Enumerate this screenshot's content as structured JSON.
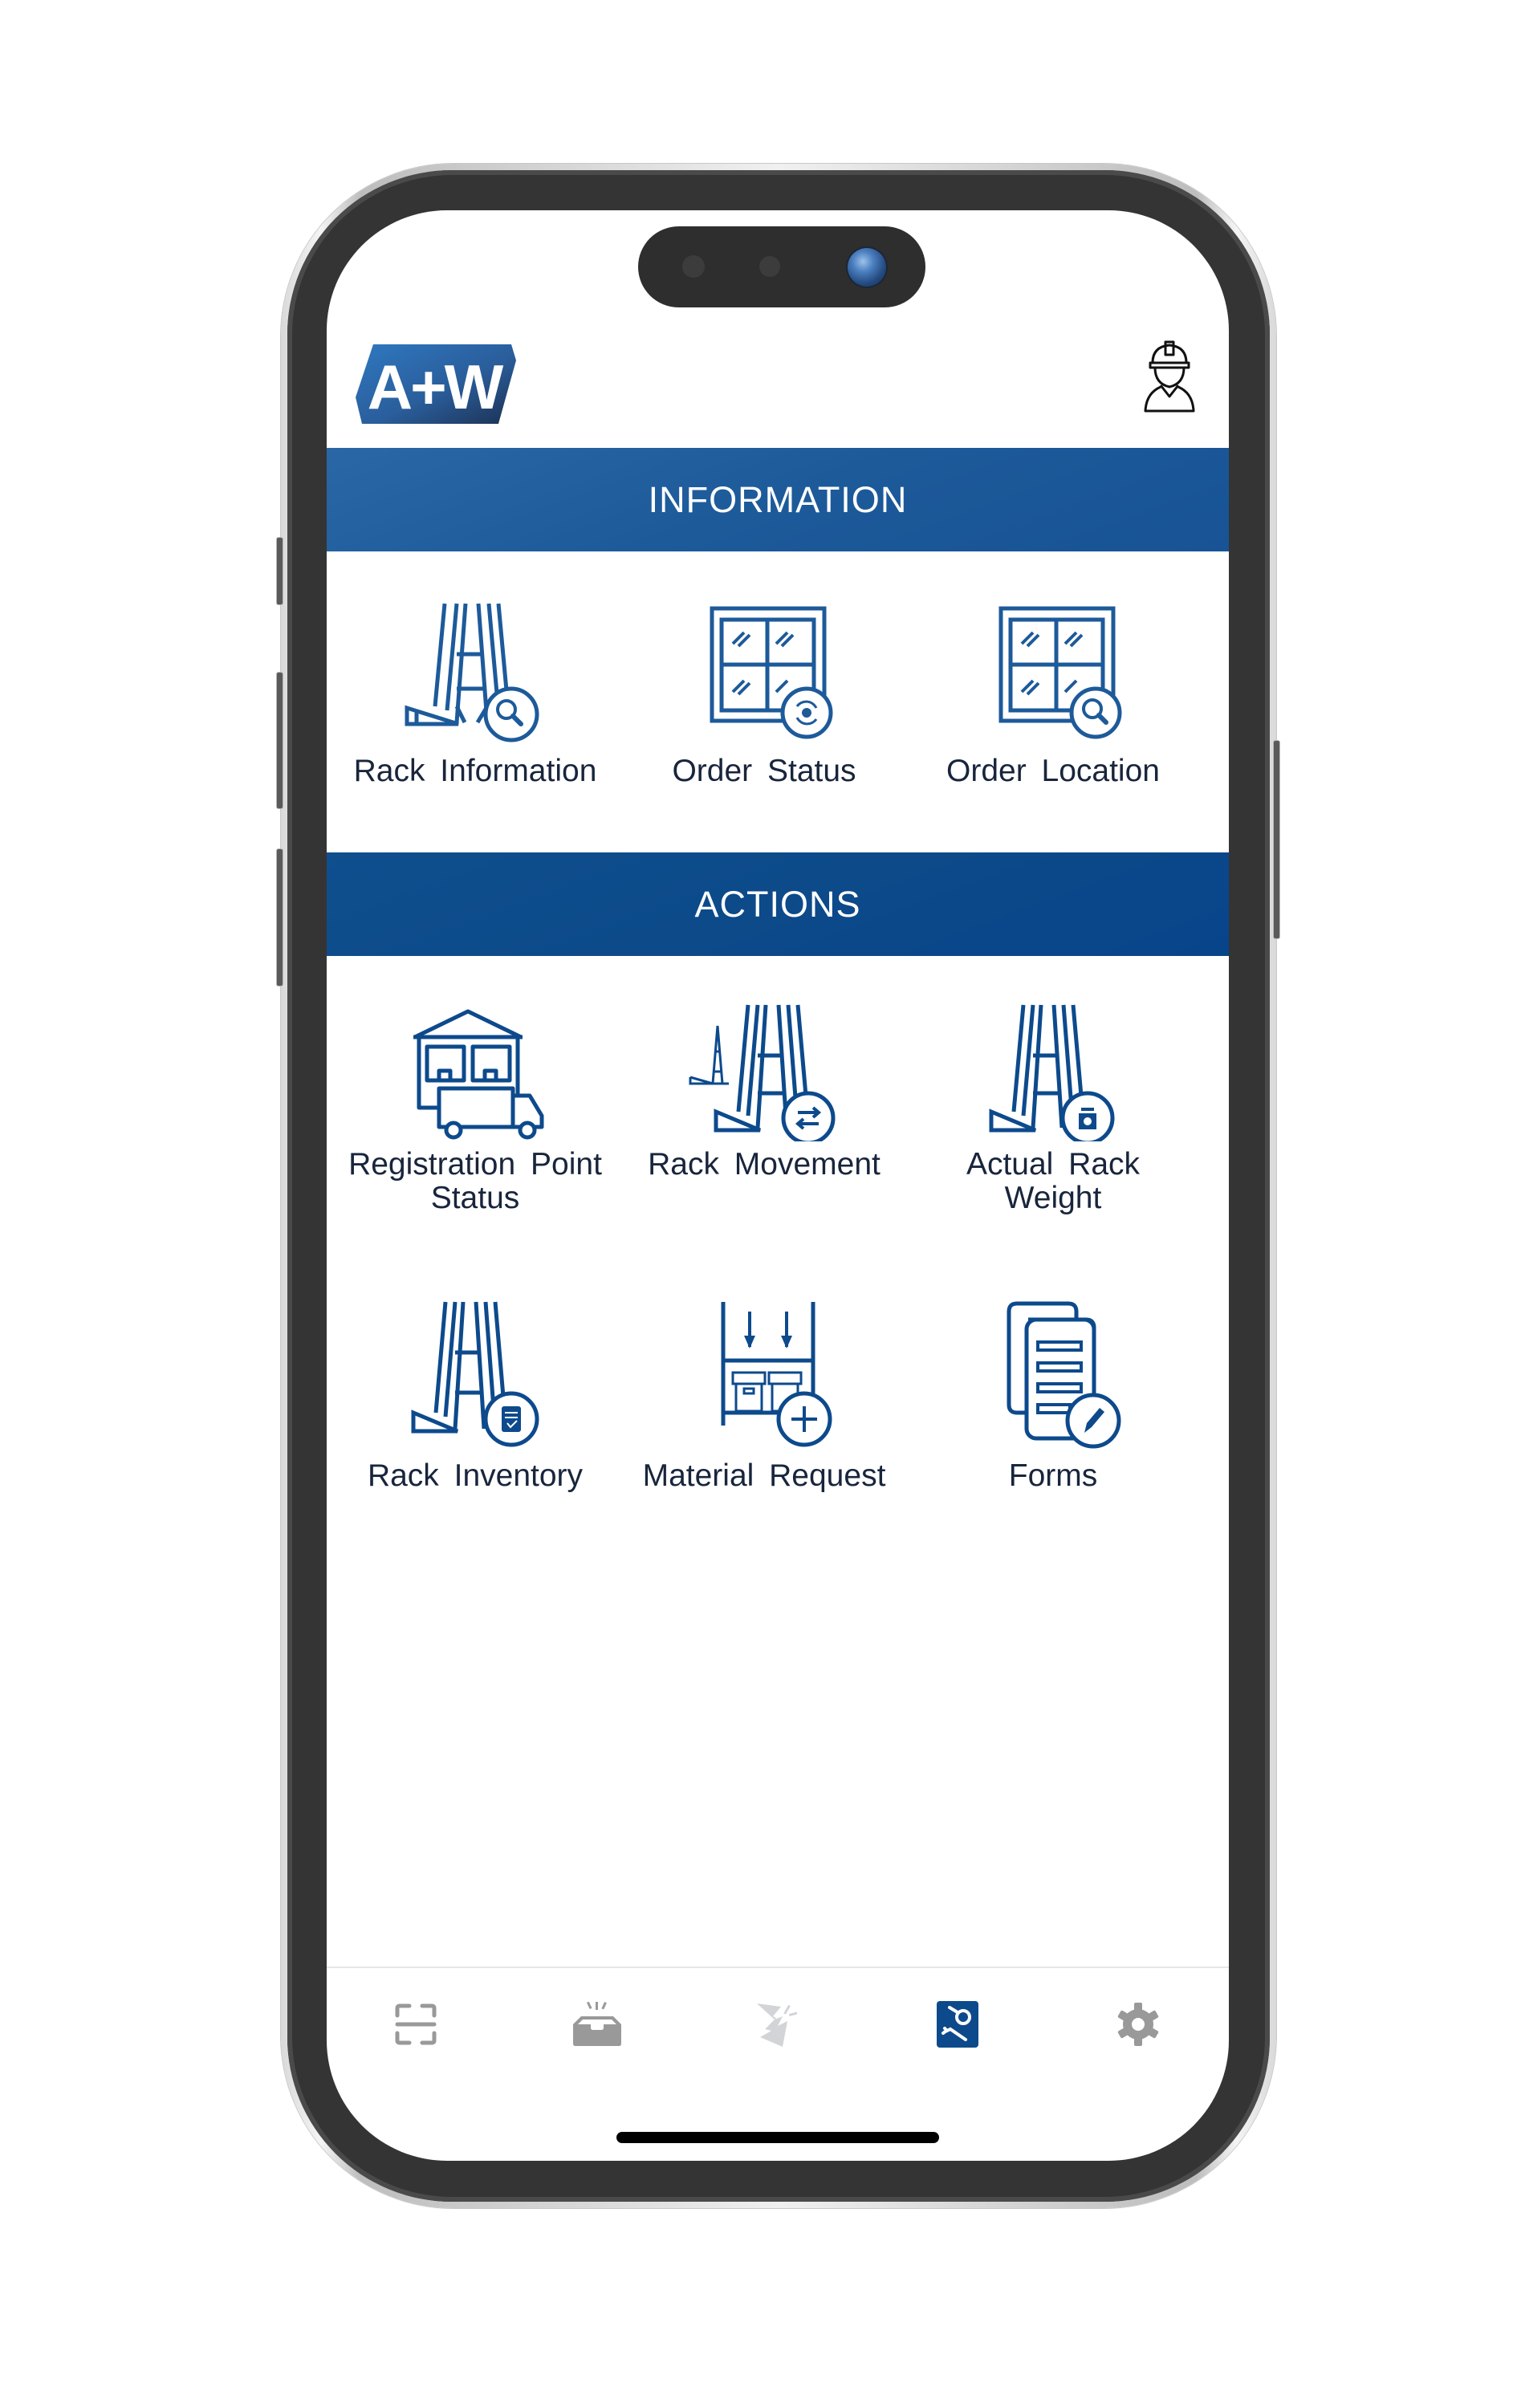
{
  "app": {
    "brand_logo_text": "A+W",
    "colors": {
      "brand_blue": "#1d5a9a",
      "actions_blue": "#0c4a8a",
      "icon_blue": "#0d4a8c",
      "label_text": "#18253c",
      "tab_inactive": "#999999",
      "tab_active_bg": "#0d4a8c"
    }
  },
  "header": {
    "logo_label": "A+W",
    "profile_icon": "construction-worker-icon"
  },
  "sections": [
    {
      "title": "INFORMATION",
      "items": [
        {
          "label": "Rack Information",
          "icon": "rack-search-icon"
        },
        {
          "label": "Order Status",
          "icon": "window-sync-icon"
        },
        {
          "label": "Order Location",
          "icon": "window-search-icon"
        }
      ]
    },
    {
      "title": "ACTIONS",
      "items": [
        {
          "label_line1": "Registration Point",
          "label_line2": "Status",
          "icon": "warehouse-truck-icon"
        },
        {
          "label_line1": "Rack Movement",
          "label_line2": "",
          "icon": "rack-transfer-icon"
        },
        {
          "label_line1": "Actual Rack",
          "label_line2": "Weight",
          "icon": "rack-scale-icon"
        },
        {
          "label_line1": "Rack Inventory",
          "label_line2": "",
          "icon": "rack-checklist-icon"
        },
        {
          "label_line1": "Material Request",
          "label_line2": "",
          "icon": "shelf-boxes-add-icon"
        },
        {
          "label_line1": "Forms",
          "label_line2": "",
          "icon": "documents-edit-icon"
        }
      ]
    }
  ],
  "tab_bar": {
    "tabs": [
      {
        "icon": "scan-icon",
        "active": false
      },
      {
        "icon": "inbox-icon",
        "active": false
      },
      {
        "icon": "broken-glass-icon",
        "active": false
      },
      {
        "icon": "tools-icon",
        "active": true
      },
      {
        "icon": "gear-icon",
        "active": false
      }
    ]
  }
}
